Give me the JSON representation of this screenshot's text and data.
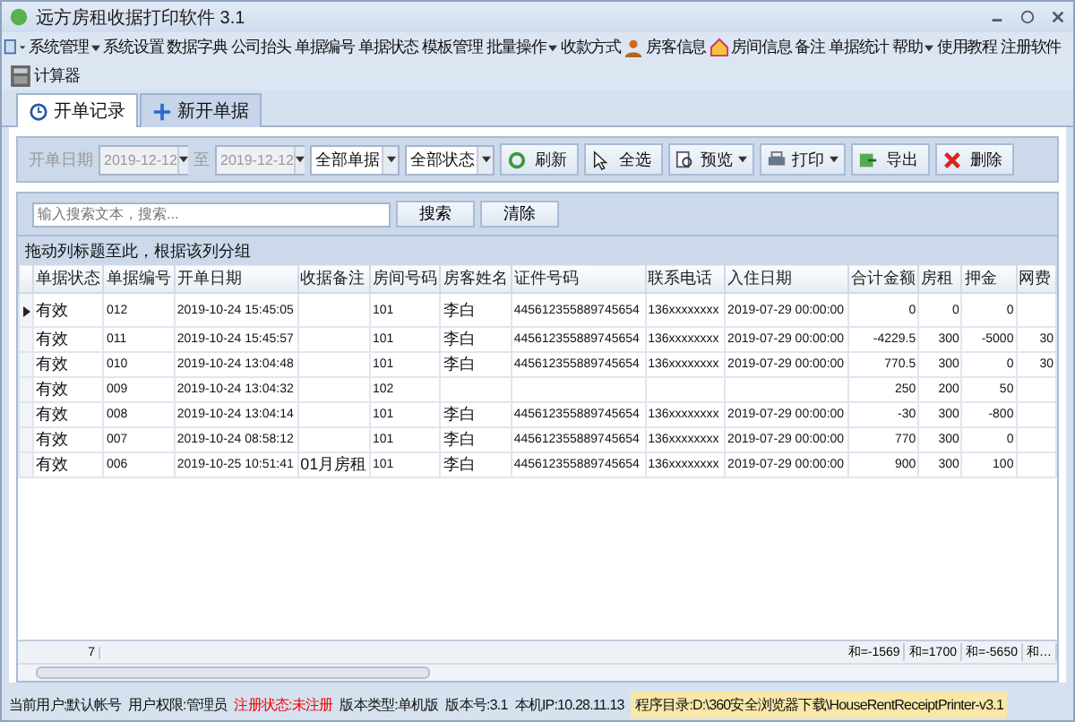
{
  "window": {
    "title": "远方房租收据打印软件 3.1"
  },
  "menu": [
    {
      "label": "系统管理",
      "kind": "dropdown"
    },
    {
      "label": "系统设置",
      "kind": "plain"
    },
    {
      "label": "数据字典",
      "kind": "plain"
    },
    {
      "label": "公司抬头",
      "kind": "plain"
    },
    {
      "label": "单据编号",
      "kind": "plain"
    },
    {
      "label": "单据状态",
      "kind": "plain"
    },
    {
      "label": "模板管理",
      "kind": "plain"
    },
    {
      "label": "批量操作",
      "kind": "dropdown"
    },
    {
      "label": "收款方式",
      "kind": "plain"
    },
    {
      "label": "房客信息",
      "kind": "person"
    },
    {
      "label": "房间信息",
      "kind": "house"
    },
    {
      "label": "备注",
      "kind": "plain"
    },
    {
      "label": "单据统计",
      "kind": "plain"
    },
    {
      "label": "帮助",
      "kind": "dropdown"
    },
    {
      "label": "使用教程",
      "kind": "plain"
    },
    {
      "label": "注册软件",
      "kind": "plain"
    }
  ],
  "tools": [
    {
      "label": "计算器"
    }
  ],
  "tabs": [
    {
      "label": "开单记录",
      "selected": true
    },
    {
      "label": "新开单据",
      "selected": false
    }
  ],
  "filter": {
    "date_label": "开单日期",
    "date_from": "2019-12-12",
    "separator": "至",
    "date_to": "2019-12-12",
    "dates_disabled": true,
    "type_select": "全部单据",
    "status_select": "全部状态"
  },
  "toolbar": [
    {
      "label": "刷新",
      "kind": "plain"
    },
    {
      "label": "全选",
      "kind": "plain"
    },
    {
      "label": "预览",
      "kind": "split"
    },
    {
      "label": "打印",
      "kind": "split"
    },
    {
      "label": "导出",
      "kind": "plain"
    },
    {
      "label": "删除",
      "kind": "plain"
    }
  ],
  "search": {
    "placeholder": "输入搜索文本，搜索...",
    "search_button": "搜索",
    "clear_button": "清除"
  },
  "group_hint": "拖动列标题至此，根据该列分组",
  "table": {
    "columns": [
      "单据状态",
      "单据编号",
      "开单日期",
      "收据备注",
      "房间号码",
      "房客姓名",
      "证件号码",
      "联系电话",
      "入住日期",
      "合计金额",
      "房租",
      "押金",
      "网费"
    ],
    "rows": [
      {
        "selected": true,
        "cells": [
          "有效",
          "012",
          "2019-10-24 15:45:05",
          "",
          "101",
          "李白",
          "445612355889745654",
          "136xxxxxxxx",
          "2019-07-29 00:00:00",
          "0",
          "0",
          "0",
          ""
        ]
      },
      {
        "selected": false,
        "cells": [
          "有效",
          "011",
          "2019-10-24 15:45:57",
          "",
          "101",
          "李白",
          "445612355889745654",
          "136xxxxxxxx",
          "2019-07-29 00:00:00",
          "-4229.5",
          "300",
          "-5000",
          "30"
        ]
      },
      {
        "selected": false,
        "cells": [
          "有效",
          "010",
          "2019-10-24 13:04:48",
          "",
          "101",
          "李白",
          "445612355889745654",
          "136xxxxxxxx",
          "2019-07-29 00:00:00",
          "770.5",
          "300",
          "0",
          "30"
        ]
      },
      {
        "selected": false,
        "cells": [
          "有效",
          "009",
          "2019-10-24 13:04:32",
          "",
          "102",
          "",
          "",
          "",
          "",
          "250",
          "200",
          "50",
          ""
        ]
      },
      {
        "selected": false,
        "cells": [
          "有效",
          "008",
          "2019-10-24 13:04:14",
          "",
          "101",
          "李白",
          "445612355889745654",
          "136xxxxxxxx",
          "2019-07-29 00:00:00",
          "-30",
          "300",
          "-800",
          ""
        ]
      },
      {
        "selected": false,
        "cells": [
          "有效",
          "007",
          "2019-10-24 08:58:12",
          "",
          "101",
          "李白",
          "445612355889745654",
          "136xxxxxxxx",
          "2019-07-29 00:00:00",
          "770",
          "300",
          "0",
          ""
        ]
      },
      {
        "selected": false,
        "cells": [
          "有效",
          "006",
          "2019-10-25 10:51:41",
          "01月房租",
          "101",
          "李白",
          "445612355889745654",
          "136xxxxxxxx",
          "2019-07-29 00:00:00",
          "900",
          "300",
          "100",
          ""
        ]
      }
    ],
    "footer": {
      "count": "7",
      "sums": [
        "和=-1569",
        "和=1700",
        "和=-5650",
        "和…"
      ]
    }
  },
  "status_bar": [
    {
      "text": "当前用户:默认帐号",
      "kind": "normal"
    },
    {
      "text": "用户权限:管理员",
      "kind": "normal"
    },
    {
      "text": "注册状态:未注册",
      "kind": "warning"
    },
    {
      "text": "版本类型:单机版",
      "kind": "normal"
    },
    {
      "text": "版本号:3.1",
      "kind": "normal"
    },
    {
      "text": "本机IP:10.28.11.13",
      "kind": "normal"
    },
    {
      "text": "程序目录:D:\\360安全浏览器下载\\HouseRentReceiptPrinter-v3.1",
      "kind": "highlight"
    }
  ]
}
